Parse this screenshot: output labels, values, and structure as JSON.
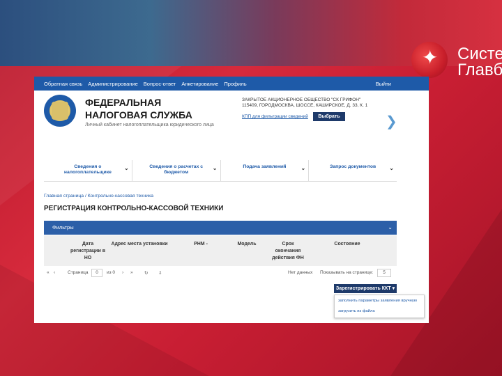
{
  "colors": {
    "accent": "#1e5aa8",
    "dark_button": "#1e3a6a",
    "slide_red": "#c81e33"
  },
  "brand": {
    "line1": "Систе",
    "line2": "Главб"
  },
  "topnav": {
    "items": [
      "Обратная связь",
      "Администрирование",
      "Вопрос-ответ",
      "Анкетирование",
      "Профиль"
    ],
    "exit": "Выйти"
  },
  "header": {
    "title_line1": "ФЕДЕРАЛЬНАЯ",
    "title_line2": "НАЛОГОВАЯ СЛУЖБА",
    "subtitle": "Личный кабинет налогоплательщика юридического лица",
    "org_line1": "ЗАКРЫТОЕ АКЦИОНЕРНОЕ ОБЩЕСТВО \"СК ГРИФОН\"",
    "org_line2": "115409, ГОРОДМОСКВА, ШОССЕ, КАШИРСКОЕ, Д. 33, К. 1",
    "kpp_link": "КПП для фильтрации сведений",
    "choose_button": "Выбрать"
  },
  "menu": [
    {
      "line1": "Сведения о",
      "line2": "налогоплательщике"
    },
    {
      "line1": "Сведения о расчетах с",
      "line2": "бюджетом"
    },
    {
      "line1": "Подача заявлений",
      "line2": ""
    },
    {
      "line1": "Запрос документов",
      "line2": ""
    }
  ],
  "breadcrumb": "Главная страница / Контрольно-кассовая техника",
  "page_title": "РЕГИСТРАЦИЯ КОНТРОЛЬНО-КАССОВОЙ ТЕХНИКИ",
  "filters": {
    "label": "Фильтры",
    "toggle": "⌄"
  },
  "table": {
    "columns": [
      {
        "l1": "Дата",
        "l2": "регистрации в",
        "l3": "НО"
      },
      {
        "l1": "Адрес места установки",
        "l2": "",
        "l3": ""
      },
      {
        "l1": "РНМ -",
        "l2": "",
        "l3": ""
      },
      {
        "l1": "Модель",
        "l2": "",
        "l3": ""
      },
      {
        "l1": "Срок",
        "l2": "окончания",
        "l3": "действия ФН"
      },
      {
        "l1": "Состояние",
        "l2": "",
        "l3": ""
      }
    ]
  },
  "pager": {
    "first": "«",
    "prev": "‹",
    "page_label": "Страница",
    "page_value": "0",
    "of_label": "из 0",
    "next": "›",
    "last": "»",
    "refresh": "↻",
    "export": "⇩",
    "no_data": "Нет данных",
    "per_page_label": "Показывать на странице:",
    "per_page_value": "5"
  },
  "register_button": "Зарегистрировать ККТ ▾",
  "register_menu": [
    "заполнить параметры заявления вручную",
    "загрузить из файла"
  ]
}
